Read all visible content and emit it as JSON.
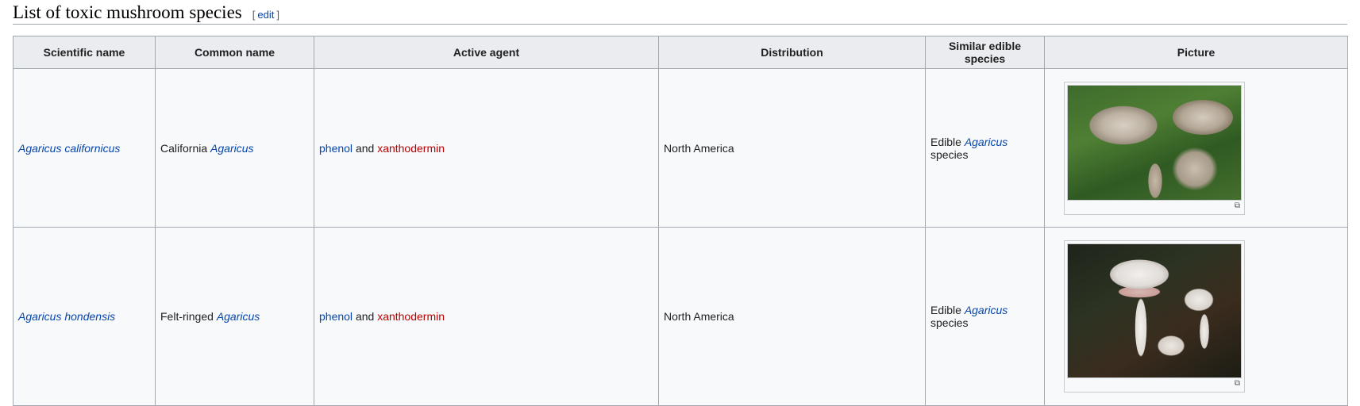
{
  "section": {
    "title": "List of toxic mushroom species",
    "edit_open": "[",
    "edit_label": "edit",
    "edit_close": "]"
  },
  "table": {
    "headers": [
      "Scientific name",
      "Common name",
      "Active agent",
      "Distribution",
      "Similar edible species",
      "Picture"
    ],
    "rows": [
      {
        "scientific_name": "Agaricus californicus",
        "common_prefix": "California",
        "common_genus": "Agaricus",
        "agent_1": "phenol",
        "agent_join": "and",
        "agent_2": "xanthodermin",
        "distribution": "North America",
        "similar_prefix": "Edible",
        "similar_genus": "Agaricus",
        "similar_suffix": "species",
        "picture_icon": "enlarge-icon"
      },
      {
        "scientific_name": "Agaricus hondensis",
        "common_prefix": "Felt-ringed",
        "common_genus": "Agaricus",
        "agent_1": "phenol",
        "agent_join": "and",
        "agent_2": "xanthodermin",
        "distribution": "North America",
        "similar_prefix": "Edible",
        "similar_genus": "Agaricus",
        "similar_suffix": "species",
        "picture_icon": "enlarge-icon"
      }
    ]
  },
  "colors": {
    "link": "#0645ad",
    "redlink": "#ba0000",
    "header_bg": "#eaecf0",
    "table_bg": "#f8f9fa",
    "border": "#a2a9b1"
  }
}
